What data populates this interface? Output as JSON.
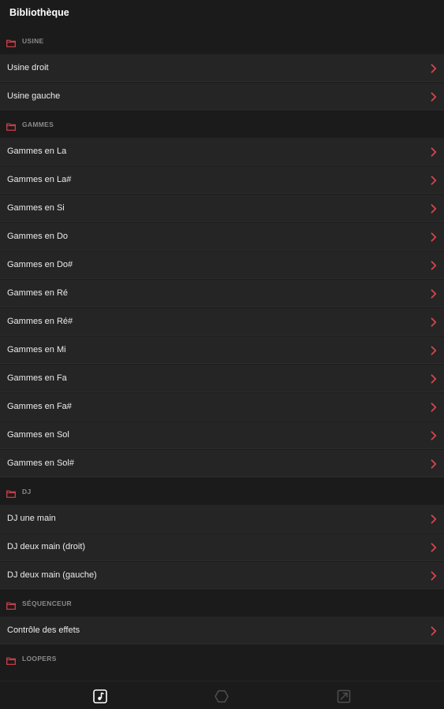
{
  "header": {
    "title": "Bibliothèque"
  },
  "sections": [
    {
      "label": "USINE",
      "items": [
        "Usine droit",
        "Usine gauche"
      ]
    },
    {
      "label": "GAMMES",
      "items": [
        "Gammes en La",
        "Gammes en La#",
        "Gammes en Si",
        "Gammes en Do",
        "Gammes en Do#",
        "Gammes en Ré",
        "Gammes en Ré#",
        "Gammes en Mi",
        "Gammes en Fa",
        "Gammes en Fa#",
        "Gammes en Sol",
        "Gammes en Sol#"
      ]
    },
    {
      "label": "DJ",
      "items": [
        "DJ une main",
        "DJ deux main (droit)",
        "DJ deux main (gauche)"
      ]
    },
    {
      "label": "SÉQUENCEUR",
      "items": [
        "Contrôle des effets"
      ]
    },
    {
      "label": "LOOPERS",
      "items": []
    }
  ],
  "icons": {
    "section": "folder-icon",
    "row": "chevron-right-icon",
    "nav": [
      "music-note-icon",
      "hexagon-icon",
      "image-icon"
    ]
  },
  "colors": {
    "accent": "#d9434d",
    "background": "#1b1b1b",
    "row_background": "#252525",
    "section_label": "#8a8a8a"
  }
}
